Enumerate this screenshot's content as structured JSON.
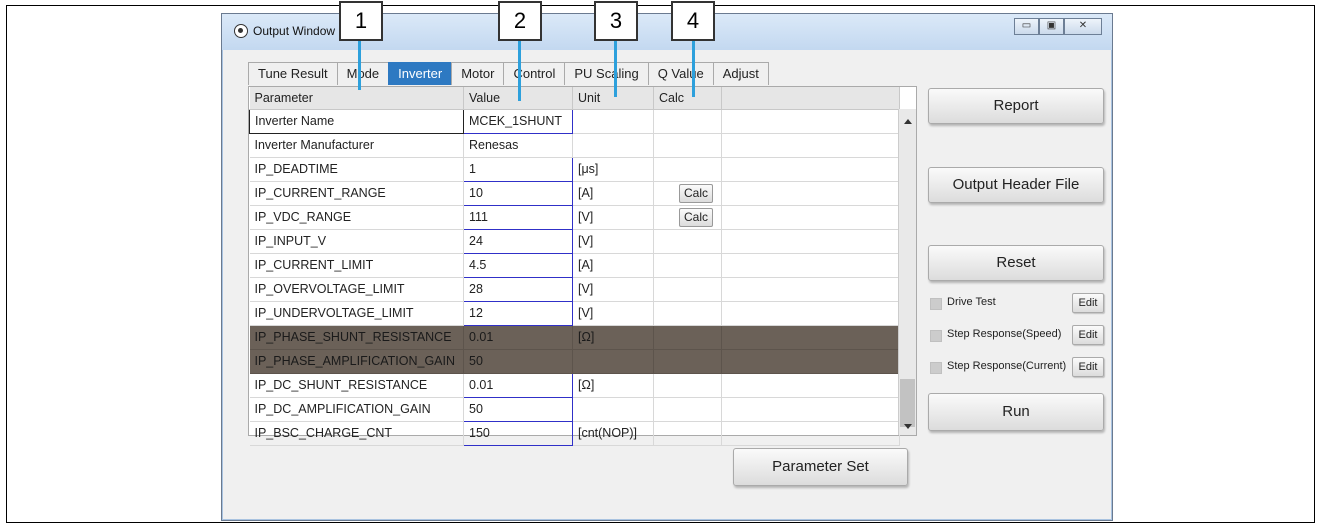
{
  "window": {
    "title": "Output Window",
    "controls": {
      "minimize": "▭",
      "maximize": "▣",
      "close": "✕"
    }
  },
  "callouts": [
    "1",
    "2",
    "3",
    "4"
  ],
  "tabs": [
    "Tune Result",
    "Mode",
    "Inverter",
    "Motor",
    "Control",
    "PU Scaling",
    "Q Value",
    "Adjust"
  ],
  "active_tab": "Inverter",
  "table": {
    "headers": [
      "Parameter",
      "Value",
      "Unit",
      "Calc"
    ],
    "rows": [
      {
        "param": "Inverter Name",
        "value": "MCEK_1SHUNT",
        "unit": "",
        "calc": ""
      },
      {
        "param": "Inverter Manufacturer",
        "value": "Renesas",
        "unit": "",
        "calc": ""
      },
      {
        "param": "IP_DEADTIME",
        "value": "1",
        "unit": "[μs]",
        "calc": ""
      },
      {
        "param": "IP_CURRENT_RANGE",
        "value": "10",
        "unit": "[A]",
        "calc": "Calc"
      },
      {
        "param": "IP_VDC_RANGE",
        "value": "111",
        "unit": "[V]",
        "calc": "Calc"
      },
      {
        "param": "IP_INPUT_V",
        "value": "24",
        "unit": "[V]",
        "calc": ""
      },
      {
        "param": "IP_CURRENT_LIMIT",
        "value": "4.5",
        "unit": "[A]",
        "calc": ""
      },
      {
        "param": "IP_OVERVOLTAGE_LIMIT",
        "value": "28",
        "unit": "[V]",
        "calc": ""
      },
      {
        "param": "IP_UNDERVOLTAGE_LIMIT",
        "value": "12",
        "unit": "[V]",
        "calc": ""
      },
      {
        "param": "IP_PHASE_SHUNT_RESISTANCE",
        "value": "0.01",
        "unit": "[Ω]",
        "calc": ""
      },
      {
        "param": "IP_PHASE_AMPLIFICATION_GAIN",
        "value": "50",
        "unit": "",
        "calc": ""
      },
      {
        "param": "IP_DC_SHUNT_RESISTANCE",
        "value": "0.01",
        "unit": "[Ω]",
        "calc": ""
      },
      {
        "param": "IP_DC_AMPLIFICATION_GAIN",
        "value": "50",
        "unit": "",
        "calc": ""
      },
      {
        "param": "IP_BSC_CHARGE_CNT",
        "value": "150",
        "unit": "[cnt(NOP)]",
        "calc": ""
      }
    ]
  },
  "buttons": {
    "report": "Report",
    "output_header": "Output Header File",
    "reset": "Reset",
    "run": "Run",
    "parameter_set": "Parameter Set",
    "edit": "Edit"
  },
  "checks": [
    "Drive Test",
    "Step Response(Speed)",
    "Step Response(Current)"
  ]
}
